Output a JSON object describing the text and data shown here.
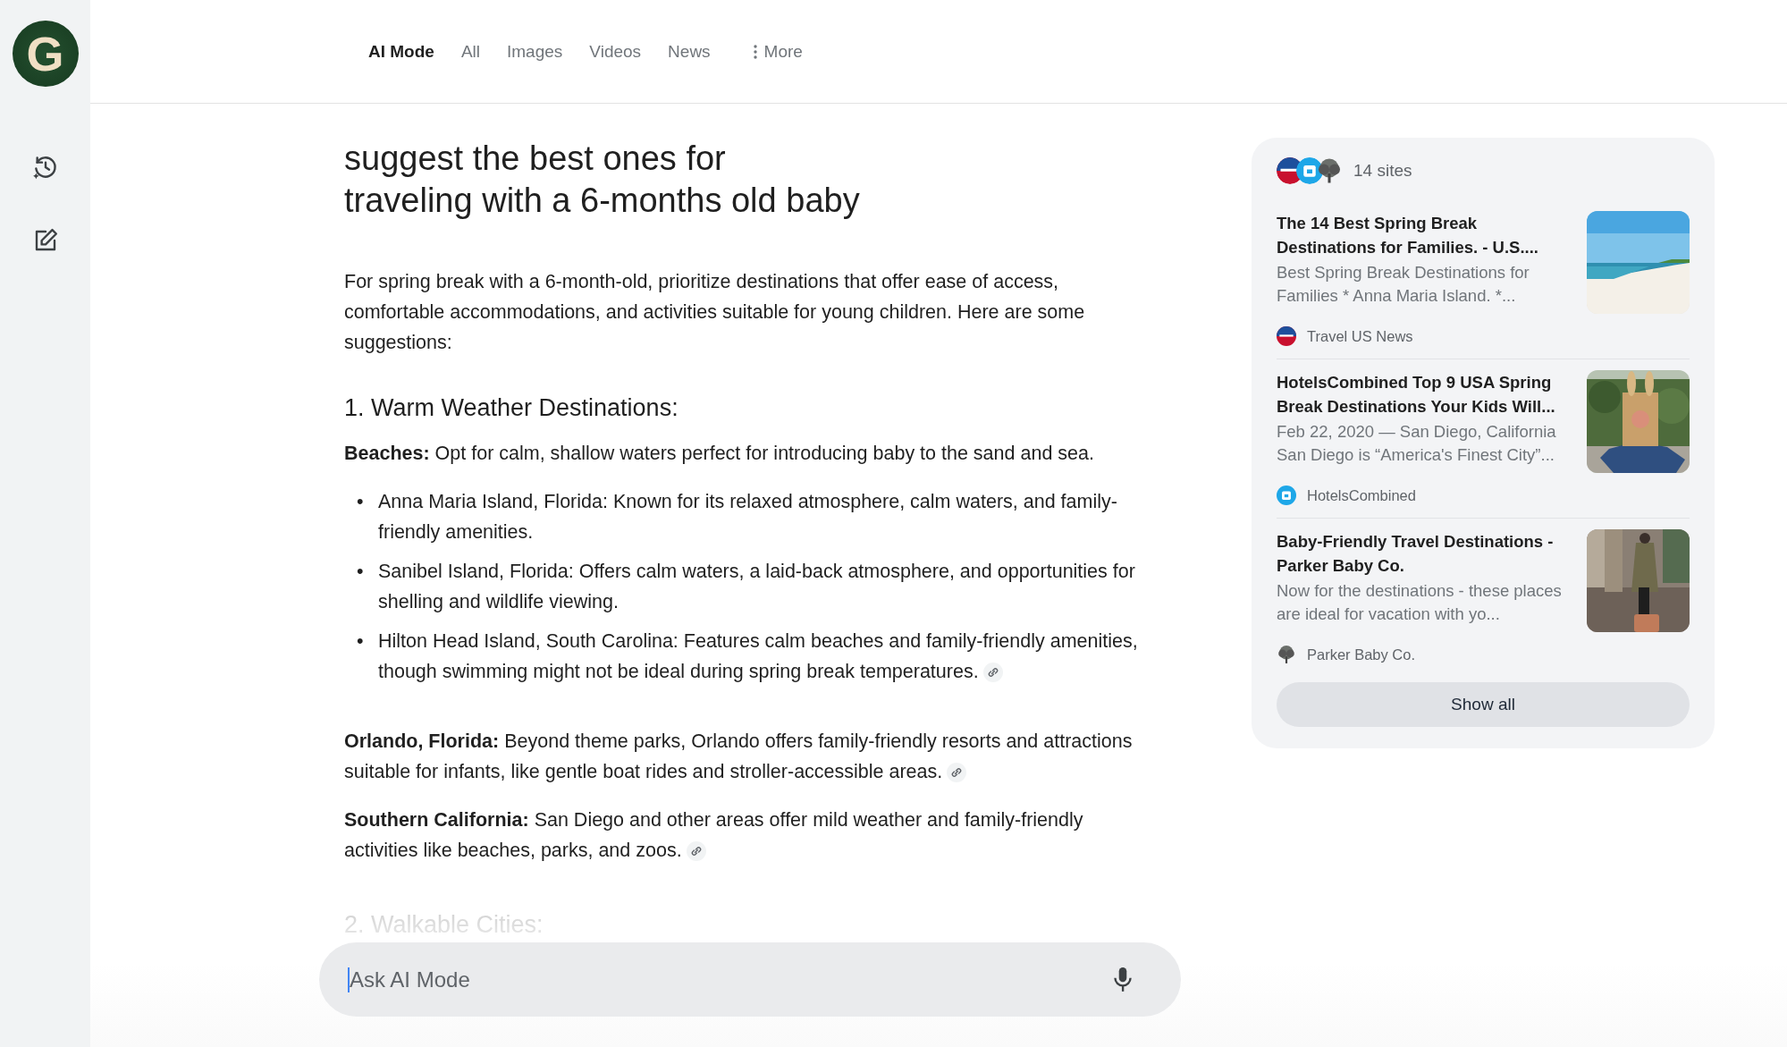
{
  "logo": {
    "letter": "G"
  },
  "sidebar": {
    "items": [
      {
        "kind": "history"
      },
      {
        "kind": "new_chat"
      }
    ]
  },
  "tabs": [
    {
      "label": "AI Mode",
      "selected": true,
      "kind": "tab"
    },
    {
      "label": "All",
      "selected": false,
      "kind": "tab"
    },
    {
      "label": "Images",
      "selected": false,
      "kind": "tab"
    },
    {
      "label": "Videos",
      "selected": false,
      "kind": "tab"
    },
    {
      "label": "News",
      "selected": false,
      "kind": "tab"
    },
    {
      "label": "More",
      "selected": false,
      "kind": "more"
    }
  ],
  "query_lines": [
    "suggest the best ones for",
    "traveling with a 6-months old baby"
  ],
  "answer": [
    {
      "kind": "paragraph",
      "text": "For spring break with a 6-month-old, prioritize destinations that offer ease of access, comfortable accommodations, and activities suitable for young children. Here are some suggestions:",
      "citation": false
    },
    {
      "kind": "heading",
      "text": "1. Warm Weather Destinations:"
    },
    {
      "kind": "paragraph",
      "text": "**Beaches:** Opt for calm, shallow waters perfect for introducing baby to the sand and sea.",
      "citation": false
    },
    {
      "kind": "bullets",
      "items": [
        {
          "marker": "•",
          "text": "Anna Maria Island, Florida: Known for its relaxed atmosphere, calm waters, and family-friendly amenities.",
          "citation": false
        },
        {
          "marker": "•",
          "text": "Sanibel Island, Florida: Offers calm waters, a laid-back atmosphere, and opportunities for shelling and wildlife viewing.",
          "citation": false
        },
        {
          "marker": "•",
          "text": "Hilton Head Island, South Carolina: Features calm beaches and family-friendly amenities, though swimming might not be ideal during spring break temperatures.",
          "citation": true
        }
      ]
    },
    {
      "kind": "paragraph",
      "text": "**Orlando, Florida:** Beyond theme parks, Orlando offers family-friendly resorts and attractions suitable for infants, like gentle boat rides and stroller-accessible areas.",
      "citation": true
    },
    {
      "kind": "paragraph",
      "text": "**Southern California:** San Diego and other areas offer mild weather and family-friendly activities like beaches, parks, and zoos.",
      "citation": true
    },
    {
      "kind": "faded_heading",
      "text": "2. Walkable Cities:"
    }
  ],
  "sources": {
    "count": "14 sites",
    "items": [
      {
        "title": "The 14 Best Spring Break Destinations for Families. - U.S....",
        "snippet": "Best Spring Break Destinations for Families * Anna Maria Island. *...",
        "site": "Travel US News"
      },
      {
        "title": "HotelsCombined Top 9 USA Spring Break Destinations Your Kids Will...",
        "snippet": "Feb 22, 2020 — San Diego, California San Diego is “America's Finest City”...",
        "site": "HotelsCombined"
      },
      {
        "title": "Baby-Friendly Travel Destinations - Parker Baby Co.",
        "snippet": "Now for the destinations - these places are ideal for vacation with yo...",
        "site": "Parker Baby Co."
      }
    ],
    "button": "Show all"
  },
  "input": {
    "placeholder": "Ask AI Mode"
  }
}
